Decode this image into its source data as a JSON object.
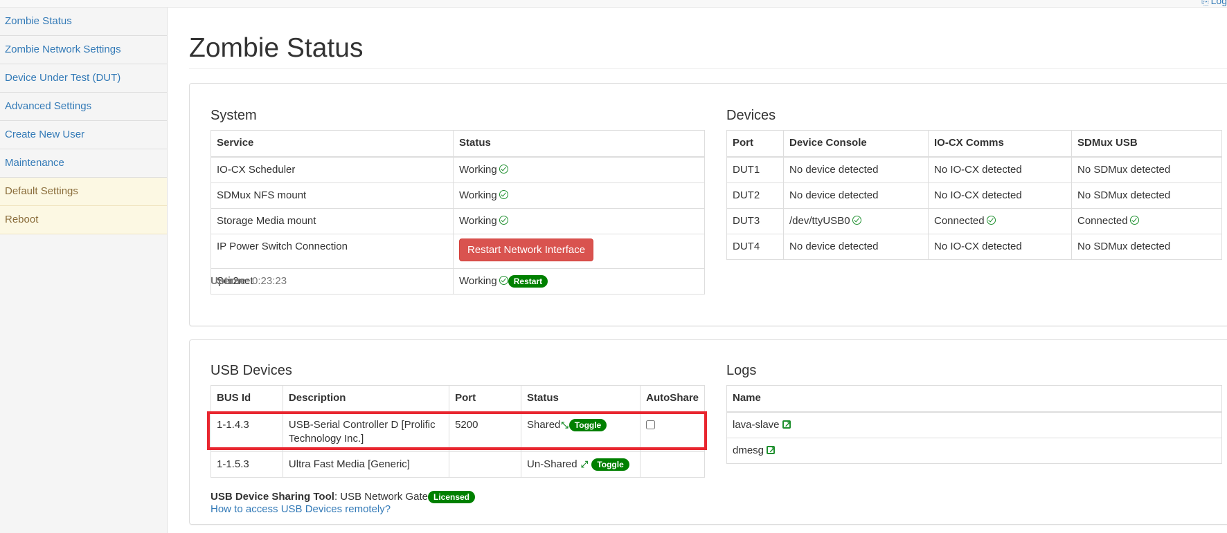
{
  "topbar": {
    "link_label": "Log"
  },
  "sidebar": {
    "items": [
      {
        "label": "Zombie Status"
      },
      {
        "label": "Zombie Network Settings"
      },
      {
        "label": "Device Under Test (DUT)"
      },
      {
        "label": "Advanced Settings"
      },
      {
        "label": "Create New User"
      },
      {
        "label": "Maintenance"
      },
      {
        "label": "Default Settings"
      },
      {
        "label": "Reboot"
      }
    ]
  },
  "page": {
    "title": "Zombie Status"
  },
  "system": {
    "title": "System",
    "headers": {
      "service": "Service",
      "status": "Status"
    },
    "rows": [
      {
        "service": "IO-CX Scheduler",
        "status": "Working"
      },
      {
        "service": "SDMux NFS mount",
        "status": "Working"
      },
      {
        "service": "Storage Media mount",
        "status": "Working"
      },
      {
        "service": "IP Power Switch Connection",
        "button": "Restart Network Interface"
      },
      {
        "service": "Ser2net",
        "status": "Working",
        "badge": "Restart"
      }
    ],
    "uptime_label": "Uptime:",
    "uptime_value": "0:23:23"
  },
  "devices": {
    "title": "Devices",
    "headers": {
      "port": "Port",
      "console": "Device Console",
      "iocx": "IO-CX Comms",
      "sdmux": "SDMux USB"
    },
    "rows": [
      {
        "port": "DUT1",
        "console": "No device detected",
        "iocx": "No IO-CX detected",
        "sdmux": "No SDMux detected"
      },
      {
        "port": "DUT2",
        "console": "No device detected",
        "iocx": "No IO-CX detected",
        "sdmux": "No SDMux detected"
      },
      {
        "port": "DUT3",
        "console": "/dev/ttyUSB0",
        "iocx": "Connected",
        "sdmux": "Connected"
      },
      {
        "port": "DUT4",
        "console": "No device detected",
        "iocx": "No IO-CX detected",
        "sdmux": "No SDMux detected"
      }
    ]
  },
  "usb": {
    "title": "USB Devices",
    "headers": {
      "bus": "BUS Id",
      "desc": "Description",
      "port": "Port",
      "status": "Status",
      "autoshare": "AutoShare"
    },
    "rows": [
      {
        "bus": "1-1.4.3",
        "desc": "USB-Serial Controller D [Prolific Technology Inc.]",
        "port": "5200",
        "status": "Shared",
        "toggle": "Toggle",
        "autoshare": false
      },
      {
        "bus": "1-1.5.3",
        "desc": "Ultra Fast Media [Generic]",
        "port": "",
        "status": "Un-Shared",
        "toggle": "Toggle"
      }
    ],
    "tool_label": "USB Device Sharing Tool",
    "tool_value": ": USB Network Gate",
    "tool_badge": "Licensed",
    "help_link": "How to access USB Devices remotely?"
  },
  "logs": {
    "title": "Logs",
    "header": "Name",
    "rows": [
      {
        "name": "lava-slave"
      },
      {
        "name": "dmesg"
      }
    ]
  },
  "colors": {
    "link": "#337ab7",
    "danger": "#d9534f",
    "success_badge": "#008000",
    "highlight": "#e8262f",
    "warning_bg": "#fcf8e3"
  }
}
